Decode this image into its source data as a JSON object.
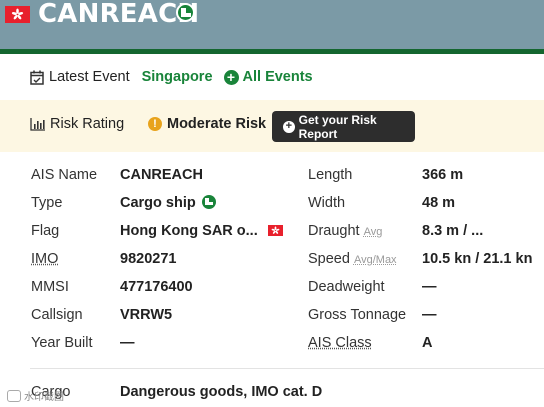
{
  "header": {
    "ship_name": "CANREACH",
    "flag_icon": "hong-kong-flag-icon",
    "type_icon": "cargo-ship-icon",
    "bar_color": "#7b9aa6",
    "accent_color": "#14662f"
  },
  "latest_event": {
    "label": "Latest Event",
    "location": "Singapore",
    "all_events_link": "All Events"
  },
  "risk": {
    "label": "Risk Rating",
    "value": "Moderate Risk",
    "report_button": "Get your Risk Report",
    "warn_glyph": "!"
  },
  "details": {
    "left": [
      {
        "label": "AIS Name",
        "value": "CANREACH"
      },
      {
        "label": "Type",
        "value": "Cargo ship"
      },
      {
        "label": "Flag",
        "value": "Hong Kong SAR o..."
      },
      {
        "label": "IMO",
        "value": "9820271"
      },
      {
        "label": "MMSI",
        "value": "477176400"
      },
      {
        "label": "Callsign",
        "value": "VRRW5"
      },
      {
        "label": "Year Built",
        "value": "—"
      }
    ],
    "right": [
      {
        "label": "Length",
        "sub": "",
        "value": "366 m"
      },
      {
        "label": "Width",
        "sub": "",
        "value": "48 m"
      },
      {
        "label": "Draught",
        "sub": "Avg",
        "value": "8.3 m / ..."
      },
      {
        "label": "Speed",
        "sub": "Avg/Max",
        "value": "10.5 kn / 21.1 kn"
      },
      {
        "label": "Deadweight",
        "sub": "",
        "value": "—"
      },
      {
        "label": "Gross Tonnage",
        "sub": "",
        "value": "—"
      },
      {
        "label": "AIS Class",
        "sub": "",
        "value": "A"
      }
    ],
    "cargo": {
      "label": "Cargo",
      "value": "Dangerous goods, IMO cat. D"
    }
  },
  "watermark": "水印截图"
}
